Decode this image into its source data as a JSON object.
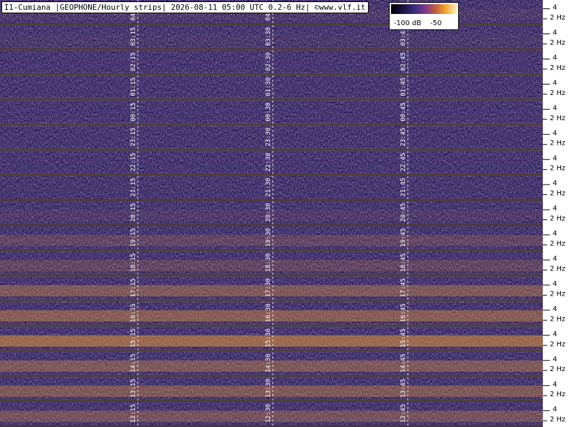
{
  "title": "I1-Cumiana |GEOPHONE/Hourly strips| 2026-08-11 05:00 UTC 0.2-6 Hz| ©www.vlf.it",
  "legend": {
    "min_label": "-100 dB",
    "max_label": "-50"
  },
  "axis": {
    "tick_high": "4",
    "tick_low": "2 Hz"
  },
  "colors": {
    "low": "#241a55",
    "mid": "#6a3a7a",
    "high": "#f0a030",
    "peak": "#fff0c0",
    "divider": "#4a3a36",
    "grid": "#ffffff"
  },
  "chart_data": {
    "type": "heatmap",
    "title": "I1-Cumiana |GEOPHONE/Hourly strips| 2026-08-11 05:00 UTC 0.2-6 Hz| ©www.vlf.it",
    "colorbar_range_db": [
      -100,
      -50
    ],
    "frequency_ticks": [
      "4",
      "2 Hz"
    ],
    "strips": [
      {
        "labels": [
          "04:15",
          "04:30",
          "04:45"
        ],
        "intensity": 0.35
      },
      {
        "labels": [
          "03:15",
          "03:30",
          "03:45"
        ],
        "intensity": 0.33
      },
      {
        "labels": [
          "02:15",
          "02:30",
          "02:45"
        ],
        "intensity": 0.18
      },
      {
        "labels": [
          "01:15",
          "01:30",
          "01:45"
        ],
        "intensity": 0.15
      },
      {
        "labels": [
          "00:15",
          "00:30",
          "00:45"
        ],
        "intensity": 0.15
      },
      {
        "labels": [
          "23:15",
          "23:30",
          "23:45"
        ],
        "intensity": 0.2
      },
      {
        "labels": [
          "22:15",
          "22:30",
          "22:45"
        ],
        "intensity": 0.18
      },
      {
        "labels": [
          "21:15",
          "21:30",
          "21:45"
        ],
        "intensity": 0.2
      },
      {
        "labels": [
          "20:15",
          "20:30",
          "20:45"
        ],
        "intensity": 0.35
      },
      {
        "labels": [
          "19:15",
          "19:30",
          "19:45"
        ],
        "intensity": 0.45
      },
      {
        "labels": [
          "18:15",
          "18:30",
          "18:45"
        ],
        "intensity": 0.45
      },
      {
        "labels": [
          "17:15",
          "17:30",
          "17:45"
        ],
        "intensity": 0.6
      },
      {
        "labels": [
          "16:15",
          "16:30",
          "16:45"
        ],
        "intensity": 0.65
      },
      {
        "labels": [
          "15:15",
          "15:30",
          "15:45"
        ],
        "intensity": 0.75
      },
      {
        "labels": [
          "14:15",
          "14:30",
          "14:45"
        ],
        "intensity": 0.6
      },
      {
        "labels": [
          "13:15",
          "13:30",
          "13:45"
        ],
        "intensity": 0.6
      },
      {
        "labels": [
          "12:15",
          "12:30",
          "12:45"
        ],
        "intensity": 0.55
      }
    ]
  }
}
